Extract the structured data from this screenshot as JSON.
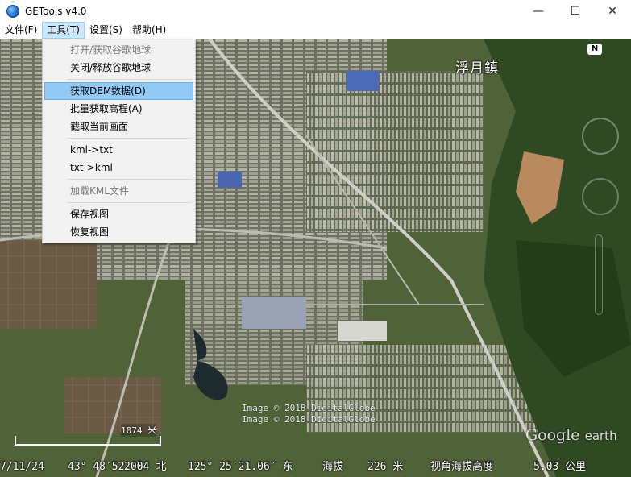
{
  "window": {
    "title": "GETools v4.0",
    "minimize_glyph": "—",
    "maximize_glyph": "☐",
    "close_glyph": "✕"
  },
  "menubar": {
    "items": [
      {
        "label": "文件(F)"
      },
      {
        "label": "工具(T)"
      },
      {
        "label": "设置(S)"
      },
      {
        "label": "帮助(H)"
      }
    ]
  },
  "tools_menu": {
    "items": [
      {
        "label": "打开/获取谷歌地球",
        "disabled": true
      },
      {
        "label": "关闭/释放谷歌地球",
        "disabled": false
      },
      {
        "label": "获取DEM数据(D)",
        "highlighted": true
      },
      {
        "label": "批量获取高程(A)"
      },
      {
        "label": "截取当前画面"
      },
      {
        "label": "kml->txt"
      },
      {
        "label": "txt->kml"
      },
      {
        "label": "加载KML文件",
        "disabled": true
      },
      {
        "label": "保存视图"
      },
      {
        "label": "恢复视图"
      }
    ]
  },
  "map": {
    "town_label": "浮月鎮",
    "copyright_lines": [
      "Image © 2018 DigitalGlobe",
      "Image © 2018 DigitalGlobe"
    ],
    "logo": {
      "google": "Google",
      "earth": "earth"
    },
    "scale_label": "1074 米",
    "compass_label": "N",
    "status": {
      "date": "7/11/24",
      "latitude": "43° 48′52.45″ 北",
      "scale_overlap": "2004",
      "longitude": "125° 25′21.06″ 东",
      "elevation_label": "海拔",
      "elevation_value": "226 米",
      "eye_alt_label": "视角海拔高度",
      "eye_alt_value": "5.03 公里"
    }
  },
  "colors": {
    "menu_highlight": "#91c9f7",
    "menu_active": "#cce8ff",
    "map_base": "#556b3d"
  },
  "icons": {
    "app": "globe-icon",
    "compass": "compass-icon"
  }
}
